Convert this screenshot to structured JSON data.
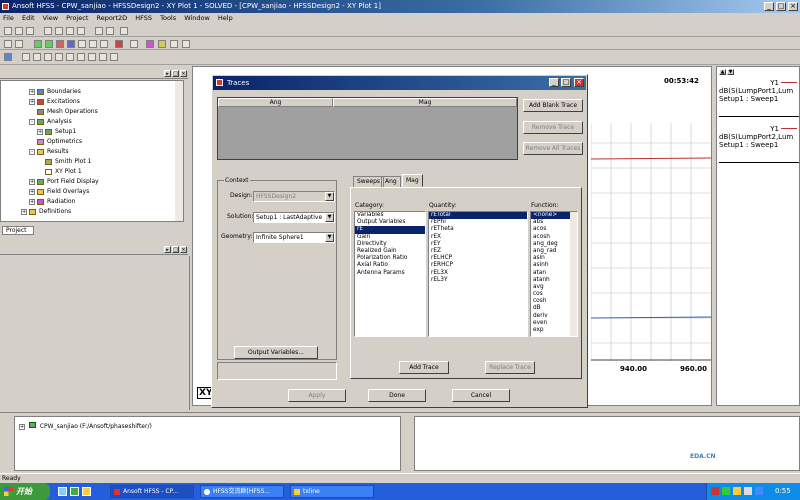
{
  "app": {
    "title": "Ansoft HFSS - CPW_sanjiao - HFSSDesign2 - XY Plot 1 - SOLVED - [CPW_sanjiao - HFSSDesign2 - XY Plot 1]"
  },
  "menu": [
    "File",
    "Edit",
    "View",
    "Project",
    "Report2D",
    "HFSS",
    "Tools",
    "Window",
    "Help"
  ],
  "tree": {
    "items": [
      {
        "label": "Boundaries",
        "exp": "+"
      },
      {
        "label": "Excitations",
        "exp": "+"
      },
      {
        "label": "Mesh Operations",
        "exp": ""
      },
      {
        "label": "Analysis",
        "exp": "-"
      },
      {
        "label": "Setup1",
        "exp": "+"
      },
      {
        "label": "Optimetrics",
        "exp": ""
      },
      {
        "label": "Results",
        "exp": "-"
      },
      {
        "label": "Smith Plot 1",
        "exp": ""
      },
      {
        "label": "XY Plot 1",
        "exp": ""
      },
      {
        "label": "Port Field Display",
        "exp": "+"
      },
      {
        "label": "Field Overlays",
        "exp": "+"
      },
      {
        "label": "Radiation",
        "exp": "+"
      },
      {
        "label": "Definitions",
        "exp": "+"
      }
    ],
    "tab": "Project"
  },
  "bottom_tree": {
    "item": "CPW_sanjiao (F:/Ansoft/phaseshifter/)"
  },
  "status": "Ready",
  "plot": {
    "time": "00:53:42",
    "ticks": [
      "940.00",
      "960.00"
    ],
    "xy_label": "XY",
    "legend": [
      {
        "label": "Y1",
        "expr": "dB(S(LumpPort1,Lum",
        "setup": "Setup1 : Sweep1",
        "color": "#c03030"
      },
      {
        "label": "Y1",
        "expr": "dB(S(LumpPort2,Lum",
        "setup": "Setup1 : Sweep1",
        "color": "#c03030"
      }
    ]
  },
  "chart_data": {
    "type": "line",
    "x_tick_labels": [
      "940.00",
      "960.00"
    ],
    "series": [
      {
        "name": "dB(S(LumpPort1,Lum",
        "color": "#c03030"
      },
      {
        "name": "dB(S(LumpPort2,Lum",
        "color": "#3060c0"
      }
    ],
    "grid": true
  },
  "dialog": {
    "title": "Traces",
    "table": {
      "col1": "Ang",
      "col2": "Mag"
    },
    "buttons": {
      "add_blank": "Add Blank Trace",
      "remove": "Remove Trace",
      "remove_all": "Remove All Traces",
      "output_vars": "Output Variables...",
      "add_trace": "Add Trace",
      "replace_trace": "Replace Trace",
      "ok": "Apply",
      "done": "Done",
      "cancel": "Cancel"
    },
    "context": {
      "heading": "Context",
      "design_label": "Design:",
      "design_value": "HFSSDesign2",
      "solution_label": "Solution:",
      "solution_value": "Setup1 : LastAdaptive",
      "geometry_label": "Geometry:",
      "geometry_value": "Infinite Sphere1"
    },
    "tabs": [
      "Sweeps",
      "Ang",
      "Mag"
    ],
    "category": {
      "label": "Category:",
      "items": [
        "Variables",
        "Output Variables",
        "rE",
        "Gain",
        "Directivity",
        "Realized Gain",
        "Polarization Ratio",
        "Axial Ratio",
        "Antenna Params"
      ],
      "selected": 2
    },
    "quantity": {
      "label": "Quantity:",
      "items": [
        "rETotal",
        "rEPhi",
        "rETheta",
        "rEX",
        "rEY",
        "rEZ",
        "rELHCP",
        "rERHCP",
        "rEL3X",
        "rEL3Y"
      ],
      "selected": 0
    },
    "function": {
      "label": "Function:",
      "items": [
        "<none>",
        "abs",
        "acos",
        "acosh",
        "ang_deg",
        "ang_rad",
        "asin",
        "asinh",
        "atan",
        "atanh",
        "avg",
        "cos",
        "cosh",
        "dB",
        "deriv",
        "even",
        "exp"
      ],
      "selected": 0
    }
  },
  "taskbar": {
    "start": "开始",
    "tasks": [
      "Ansoft HFSS - CP...",
      "HFSS交流群[HFSS...",
      "txline"
    ],
    "clock": "0:55"
  },
  "watermark": "EDA.CN"
}
